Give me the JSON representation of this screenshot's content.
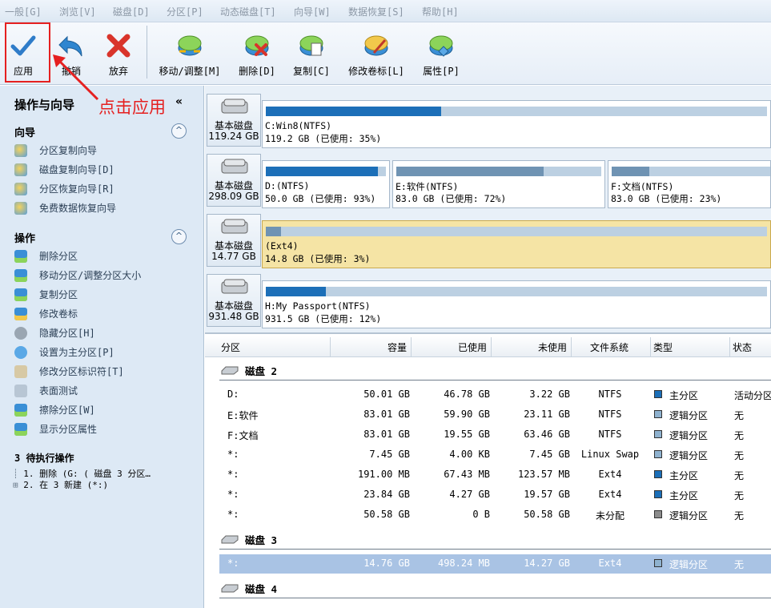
{
  "menu": [
    "一般[G]",
    "浏览[V]",
    "磁盘[D]",
    "分区[P]",
    "动态磁盘[T]",
    "向导[W]",
    "数据恢复[S]",
    "帮助[H]"
  ],
  "toolbar": {
    "apply": "应用",
    "undo": "撤销",
    "discard": "放弃",
    "move": "移动/调整[M]",
    "delete": "删除[D]",
    "copy": "复制[C]",
    "label": "修改卷标[L]",
    "props": "属性[P]"
  },
  "annotation": "点击应用",
  "panel": {
    "title": "操作与向导",
    "collapse": "«",
    "wizard_title": "向导",
    "wizard_items": [
      "分区复制向导",
      "磁盘复制向导[D]",
      "分区恢复向导[R]",
      "免费数据恢复向导"
    ],
    "ops_title": "操作",
    "ops_items": [
      "删除分区",
      "移动分区/调整分区大小",
      "复制分区",
      "修改卷标",
      "隐藏分区[H]",
      "设置为主分区[P]",
      "修改分区标识符[T]",
      "表面测试",
      "擦除分区[W]",
      "显示分区属性"
    ],
    "toggle": "^",
    "pending_title": "3 待执行操作",
    "pending": [
      "1. 删除 (G: ( 磁盘 3 分区…",
      "2. 在 3 新建 (*:)"
    ]
  },
  "disks": [
    {
      "name": "基本磁盘",
      "size": "119.24 GB",
      "parts": [
        {
          "name": "C:Win8(NTFS)",
          "info": "119.2 GB (已使用: 35%)",
          "used": 0.35
        }
      ]
    },
    {
      "name": "基本磁盘",
      "size": "298.09 GB",
      "parts": [
        {
          "name": "D:(NTFS)",
          "info": "50.0 GB (已使用: 93%)",
          "used": 0.93
        },
        {
          "name": "E:软件(NTFS)",
          "info": "83.0 GB (已使用: 72%)",
          "used": 0.72
        },
        {
          "name": "F:文档(NTFS)",
          "info": "83.0 GB (已使用: 23%)",
          "used": 0.23
        }
      ]
    },
    {
      "name": "基本磁盘",
      "size": "14.77 GB",
      "parts": [
        {
          "name": "(Ext4)",
          "info": "14.8 GB (已使用: 3%)",
          "used": 0.03
        }
      ]
    },
    {
      "name": "基本磁盘",
      "size": "931.48 GB",
      "parts": [
        {
          "name": "H:My Passport(NTFS)",
          "info": "931.5 GB (已使用: 12%)",
          "used": 0.12
        }
      ]
    }
  ],
  "table": {
    "headers": [
      "分区",
      "容量",
      "已使用",
      "未使用",
      "文件系统",
      "类型",
      "状态"
    ],
    "groups": [
      {
        "label": "磁盘 2",
        "rows": [
          [
            "D:",
            "50.01 GB",
            "46.78 GB",
            "3.22 GB",
            "NTFS",
            "主分区",
            "活动分区"
          ],
          [
            "E:软件",
            "83.01 GB",
            "59.90 GB",
            "23.11 GB",
            "NTFS",
            "逻辑分区",
            "无"
          ],
          [
            "F:文档",
            "83.01 GB",
            "19.55 GB",
            "63.46 GB",
            "NTFS",
            "逻辑分区",
            "无"
          ],
          [
            "*:",
            "7.45 GB",
            "4.00 KB",
            "7.45 GB",
            "Linux Swap",
            "逻辑分区",
            "无"
          ],
          [
            "*:",
            "191.00 MB",
            "67.43 MB",
            "123.57 MB",
            "Ext4",
            "主分区",
            "无"
          ],
          [
            "*:",
            "23.84 GB",
            "4.27 GB",
            "19.57 GB",
            "Ext4",
            "主分区",
            "无"
          ],
          [
            "*:",
            "50.58 GB",
            "0 B",
            "50.58 GB",
            "未分配",
            "逻辑分区",
            "无"
          ]
        ]
      },
      {
        "label": "磁盘 3",
        "rows": [
          [
            "*:",
            "14.76 GB",
            "498.24 MB",
            "14.27 GB",
            "Ext4",
            "逻辑分区",
            "无"
          ]
        ]
      },
      {
        "label": "磁盘 4",
        "rows": []
      }
    ]
  },
  "colors": {
    "primary": "#1c6fb8",
    "logical": "#8fb2cf",
    "unalloc": "#8c8c8c",
    "selected_row": "#a9c3e4",
    "selected_part": "#f5e4a5",
    "annotation": "#e52020"
  }
}
